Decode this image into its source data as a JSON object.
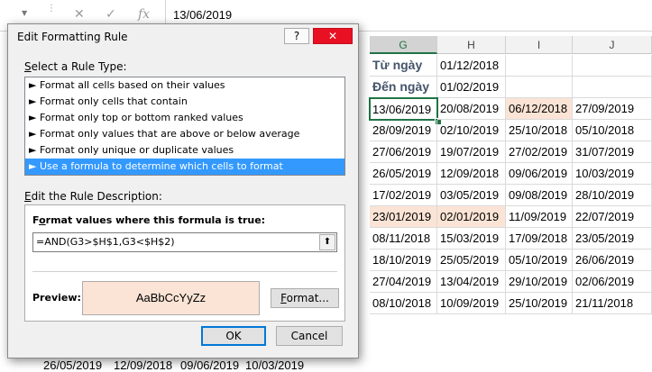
{
  "formula_bar": {
    "cancel_icon": "✕",
    "enter_icon": "✓",
    "fx_icon": "fx",
    "value": "13/06/2019"
  },
  "columns": [
    "G",
    "H",
    "I",
    "J"
  ],
  "cells": {
    "g2": "Từ ngày",
    "h2": "01/12/2018",
    "g3": "Đến ngày",
    "h3": "01/02/2019",
    "rows": [
      [
        "13/06/2019",
        "20/08/2019",
        "06/12/2018",
        "27/09/2019"
      ],
      [
        "28/09/2019",
        "02/10/2019",
        "25/10/2018",
        "05/10/2018"
      ],
      [
        "27/06/2019",
        "19/07/2019",
        "27/02/2019",
        "31/07/2019"
      ],
      [
        "26/05/2019",
        "12/09/2018",
        "09/06/2019",
        "10/03/2019"
      ],
      [
        "17/02/2019",
        "03/05/2019",
        "09/08/2019",
        "28/10/2019"
      ],
      [
        "23/01/2019",
        "02/01/2019",
        "11/09/2019",
        "22/07/2019"
      ],
      [
        "08/11/2018",
        "15/03/2019",
        "17/09/2018",
        "23/05/2019"
      ],
      [
        "18/10/2019",
        "25/05/2019",
        "05/10/2019",
        "26/06/2019"
      ],
      [
        "27/04/2019",
        "13/04/2019",
        "29/10/2019",
        "02/06/2019"
      ],
      [
        "08/10/2018",
        "10/09/2019",
        "25/10/2019",
        "21/11/2018"
      ]
    ]
  },
  "bottom_row": [
    "26/05/2019",
    "12/09/2018",
    "09/06/2019",
    "10/03/2019"
  ],
  "dialog": {
    "title": "Edit Formatting Rule",
    "help_label": "?",
    "close_label": "✕",
    "select_type_label_u": "S",
    "select_type_label_rest": "elect a Rule Type:",
    "rule_types": [
      "Format all cells based on their values",
      "Format only cells that contain",
      "Format only top or bottom ranked values",
      "Format only values that are above or below average",
      "Format only unique or duplicate values",
      "Use a formula to determine which cells to format"
    ],
    "edit_desc_label_u": "E",
    "edit_desc_label_rest": "dit the Rule Description:",
    "formula_label_pre": "F",
    "formula_label_u": "o",
    "formula_label_rest": "rmat values where this formula is true:",
    "formula_value": "=AND(G3>$H$1,G3<$H$2)",
    "collapse_icon": "⬆",
    "preview_label": "Preview:",
    "preview_text": "AaBbCcYyZz",
    "format_button_u": "F",
    "format_button_rest": "ormat...",
    "ok_label": "OK",
    "cancel_label": "Cancel"
  }
}
